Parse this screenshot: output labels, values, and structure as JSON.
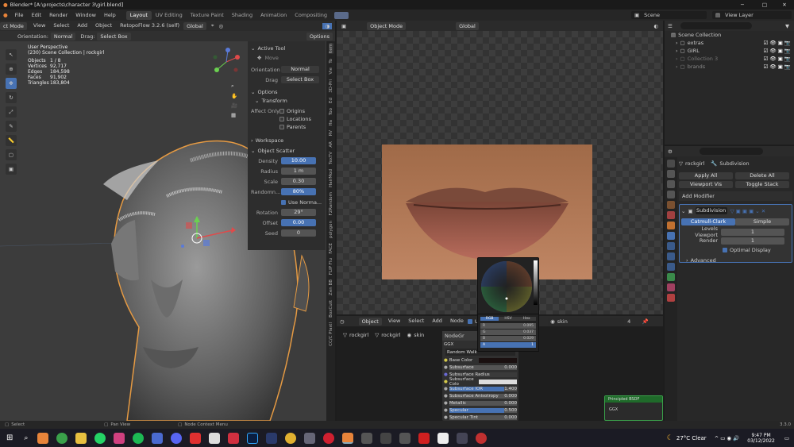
{
  "window": {
    "title": "Blender* [A:\\projects\\character 3\\girl.blend]",
    "min": "─",
    "max": "□",
    "close": "✕"
  },
  "menu": [
    "File",
    "Edit",
    "Render",
    "Window",
    "Help"
  ],
  "workspaces": [
    "Layout",
    "UV Editing",
    "Texture Paint",
    "Shading",
    "Animation",
    "Compositing"
  ],
  "scene": {
    "label": "Scene",
    "view_layer": "View Layer"
  },
  "viewport": {
    "mode": "ct Mode",
    "menus": [
      "View",
      "Select",
      "Add",
      "Object"
    ],
    "addon": "RetopoFlow 3.2.6 (self)",
    "orientation_menu": "Global",
    "tool_orientation_label": "Orientation:",
    "tool_orientation": "Normal",
    "drag_label": "Drag:",
    "drag": "Select Box",
    "options": "Options",
    "view_name": "User Perspective",
    "collection": "(230) Scene Collection | rockgirl",
    "stats": [
      {
        "k": "Objects",
        "v": "1 / 8"
      },
      {
        "k": "Vertices",
        "v": "92,717"
      },
      {
        "k": "Edges",
        "v": "184,598"
      },
      {
        "k": "Faces",
        "v": "91,902"
      },
      {
        "k": "Triangles",
        "v": "183,804"
      }
    ]
  },
  "npanel": {
    "active_tool": "Active Tool",
    "move": "Move",
    "orientation_label": "Orientation",
    "orientation": "Normal",
    "drag_label": "Drag",
    "drag": "Select Box",
    "options": "Options",
    "transform": "Transform",
    "affect_only": "Affect Only",
    "origins": "Origins",
    "locations": "Locations",
    "parents": "Parents",
    "workspace": "Workspace",
    "object_scatter": "Object Scatter",
    "density_l": "Density",
    "density": "10.00",
    "radius_l": "Radius",
    "radius": "1 m",
    "scale_l": "Scale",
    "scale": "0.30",
    "random_l": "Randomn...",
    "random": "80%",
    "use_normal": "Use Norma...",
    "rotation_l": "Rotation",
    "rotation": "29°",
    "offset_l": "Offset",
    "offset": "0.00",
    "seed_l": "Seed",
    "seed": "0"
  },
  "vtabs": [
    "Item",
    "To",
    "Vie",
    "3D-Pri",
    "Ed",
    "Too",
    "Ha",
    "RV",
    "AR",
    "TexTV",
    "HairMod",
    "F2Random",
    "polygon",
    "FACE",
    "FLIP Flu",
    "Zen BB",
    "BoxCutt",
    "CC/C Plastl"
  ],
  "image_editor": {
    "mode": "Object Mode",
    "orientation": "Global"
  },
  "color_picker": {
    "tabs": [
      "RGB",
      "HSV",
      "Hex"
    ],
    "r_l": "R",
    "r": "0.095",
    "g_l": "G",
    "g": "0.037",
    "b_l": "B",
    "b": "0.029",
    "a_l": "A",
    "a": "1"
  },
  "node_editor": {
    "menu_object": "Object",
    "menus": [
      "View",
      "Select",
      "Add",
      "Node"
    ],
    "use_label": "Use",
    "material": "skin",
    "users": "4",
    "breadcrumb": [
      "rockgirl",
      "rockgirl",
      "skin"
    ],
    "node_title": "NodeGr",
    "node_sub": "GGX",
    "random_walk": "Random Walk",
    "base_color": "Base Color",
    "rows": [
      {
        "k": "Subsurface",
        "v": "0.000"
      },
      {
        "k": "Subsurface Radius",
        "v": ""
      },
      {
        "k": "Subsurface Colo",
        "v": ""
      },
      {
        "k": "Subsurface IOR",
        "v": "1.400"
      },
      {
        "k": "Subsurface Anisotropy",
        "v": "0.000"
      },
      {
        "k": "Metallic",
        "v": "0.000"
      },
      {
        "k": "Specular",
        "v": "0.500"
      },
      {
        "k": "Specular Tint",
        "v": "0.000"
      }
    ],
    "principled": "Principled BSDF",
    "principled_sub": "GGX"
  },
  "outliner": {
    "root": "Scene Collection",
    "items": [
      "extras",
      "GIRL",
      "Collection 3",
      "brands"
    ]
  },
  "properties": {
    "object": "rockgirl",
    "modifier": "Subdivision",
    "apply_all": "Apply All",
    "delete_all": "Delete All",
    "viewport_vis": "Viewport Vis",
    "toggle_stack": "Toggle Stack",
    "add_modifier": "Add Modifier",
    "mod_name": "Subdivision",
    "catmull": "Catmull-Clark",
    "simple": "Simple",
    "levels_l": "Levels Viewport",
    "levels": "1",
    "render_l": "Render",
    "render": "1",
    "optimal": "Optimal Display",
    "advanced": "Advanced"
  },
  "statusbar": {
    "select": "Select",
    "pan": "Pan View",
    "context": "Node Context Menu",
    "version": "3.3.0"
  },
  "taskbar": {
    "weather": "27°C  Clear",
    "time": "9:47 PM",
    "date": "03/12/2022"
  },
  "colors": {
    "accent": "#4772b3",
    "orange": "#e8843a",
    "bg": "#1d1d1d"
  }
}
